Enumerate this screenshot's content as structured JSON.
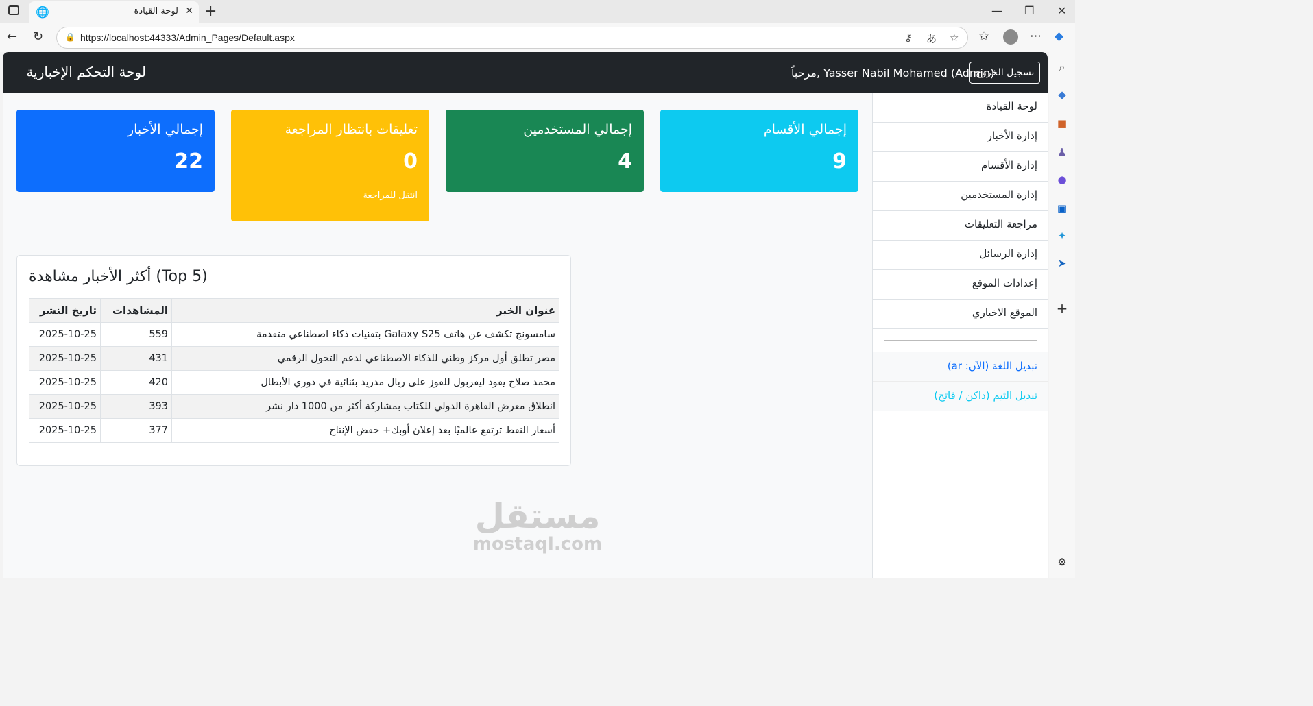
{
  "browser": {
    "tab_title": "لوحة القيادة",
    "url": "https://localhost:44333/Admin_Pages/Default.aspx"
  },
  "navbar": {
    "brand": "لوحة التحكم الإخبارية",
    "welcome": "مرحباً, Yasser Nabil Mohamed (Admin)",
    "logout_label": "تسجيل الخروج"
  },
  "sidebar": {
    "items": [
      {
        "label": "لوحة القيادة"
      },
      {
        "label": "إدارة الأخبار"
      },
      {
        "label": "إدارة الأقسام"
      },
      {
        "label": "إدارة المستخدمين"
      },
      {
        "label": "مراجعة التعليقات"
      },
      {
        "label": "إدارة الرسائل"
      },
      {
        "label": "إعدادات الموقع"
      },
      {
        "label": "الموقع الاخباري"
      }
    ],
    "language_toggle": "تبديل اللغة (الآن: ar)",
    "theme_toggle": "تبديل الثيم (داكن / فاتح)"
  },
  "cards": [
    {
      "title": "إجمالي الأقسام",
      "value": "9",
      "color": "#0dcaf0"
    },
    {
      "title": "إجمالي المستخدمين",
      "value": "4",
      "color": "#198754"
    },
    {
      "title": "تعليقات بانتظار المراجعة",
      "value": "0",
      "link": "انتقل للمراجعة",
      "color": "#ffc107"
    },
    {
      "title": "إجمالي الأخبار",
      "value": "22",
      "color": "#0d6efd"
    }
  ],
  "top_news": {
    "title": "أكثر الأخبار مشاهدة (Top 5)",
    "headers": {
      "title": "عنوان الخبر",
      "views": "المشاهدات",
      "date": "تاريخ النشر"
    },
    "rows": [
      {
        "title": "سامسونج تكشف عن هاتف Galaxy S25 بتقنيات ذكاء اصطناعي متقدمة",
        "views": "559",
        "date": "2025-10-25"
      },
      {
        "title": "مصر تطلق أول مركز وطني للذكاء الاصطناعي لدعم التحول الرقمي",
        "views": "431",
        "date": "2025-10-25"
      },
      {
        "title": "محمد صلاح يقود ليفربول للفوز على ريال مدريد بثنائية في دوري الأبطال",
        "views": "420",
        "date": "2025-10-25"
      },
      {
        "title": "انطلاق معرض القاهرة الدولي للكتاب بمشاركة أكثر من 1000 دار نشر",
        "views": "393",
        "date": "2025-10-25"
      },
      {
        "title": "أسعار النفط ترتفع عالميًا بعد إعلان أوبك+ خفض الإنتاج",
        "views": "377",
        "date": "2025-10-25"
      }
    ]
  },
  "watermark": {
    "ar": "مستقل",
    "en": "mostaql.com"
  },
  "colors": {
    "link_primary": "#0d6efd",
    "link_info": "#0dcaf0",
    "navbar": "#212529"
  }
}
